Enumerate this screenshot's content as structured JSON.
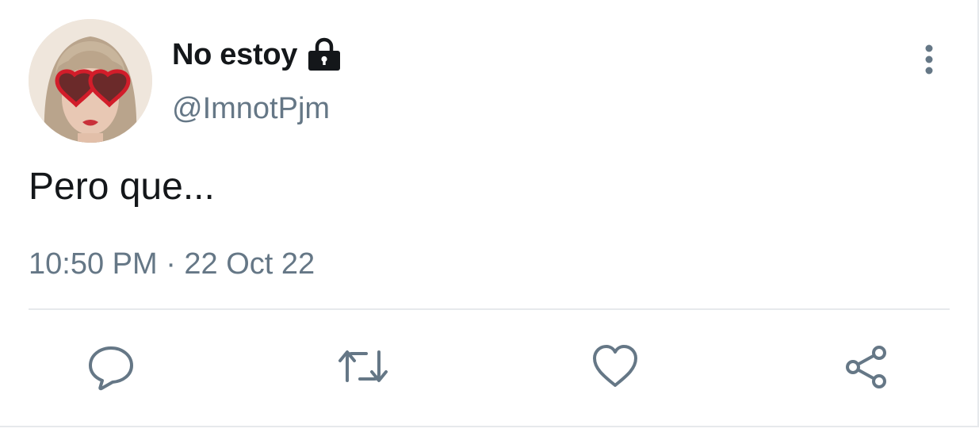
{
  "tweet": {
    "author": {
      "display_name": "No estoy",
      "handle": "@ImnotPjm",
      "protected_icon": "lock-icon",
      "avatar": "avatar-photo"
    },
    "text": "Pero que...",
    "timestamp": "10:50 PM · 22 Oct 22",
    "actions": [
      {
        "name": "reply",
        "icon": "reply-icon"
      },
      {
        "name": "retweet",
        "icon": "retweet-icon"
      },
      {
        "name": "like",
        "icon": "heart-icon"
      },
      {
        "name": "share",
        "icon": "share-icon"
      }
    ],
    "colors": {
      "primary_text": "#14171a",
      "secondary_text": "#657786",
      "divider": "#e6e9ec"
    }
  }
}
